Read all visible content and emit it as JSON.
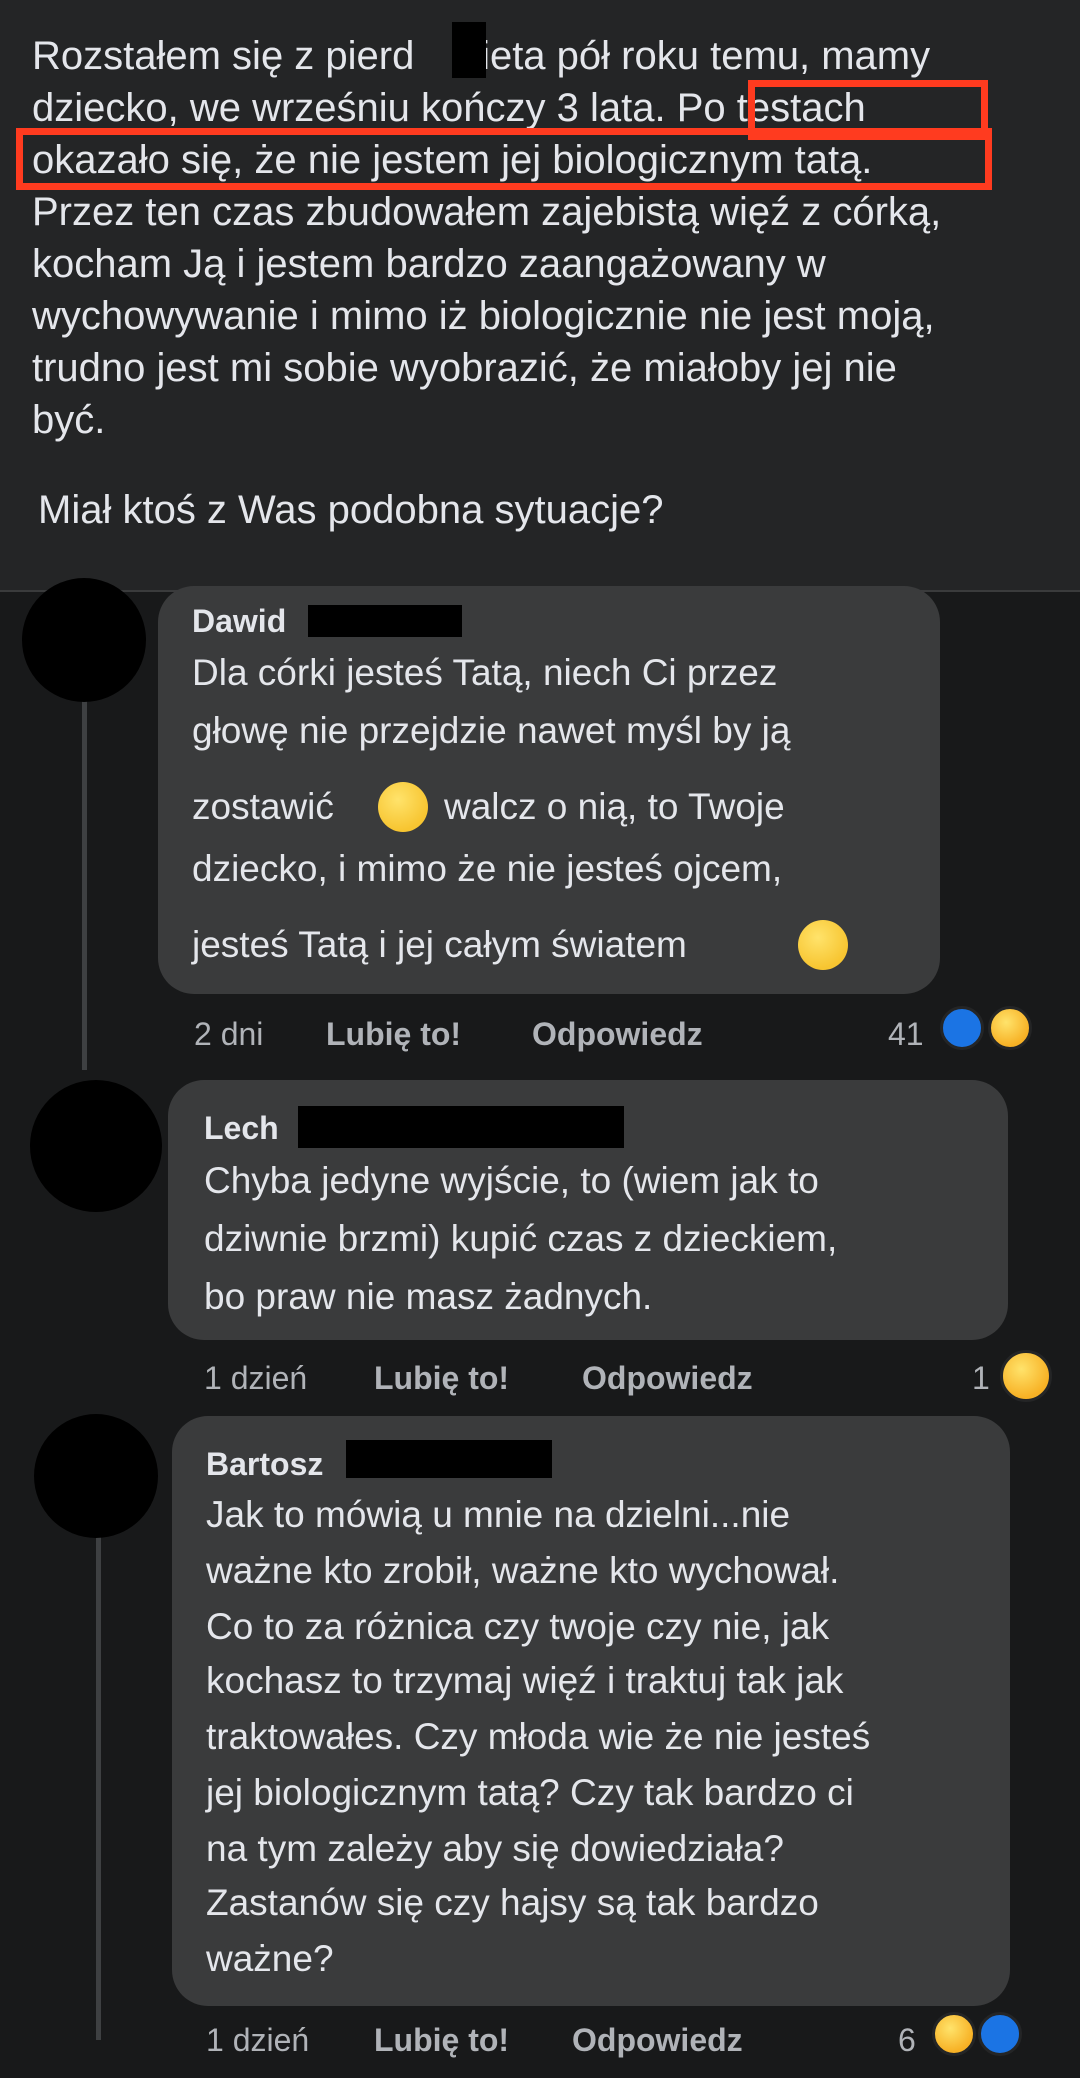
{
  "post": {
    "text": "Rozstałem się z pierd    nieta pół roku temu, mamy\ndziecko, we wrześniu kończy 3 lata. Po testach\nokazało się, że nie jestem jej biologicznym tatą.\nPrzez ten czas zbudowałem zajebistą więź z córką,\nkocham Ją i jestem bardzo zaangażowany w\nwychowywanie i mimo iż biologicznie nie jest moją,\ntrudno jest mi sobie wyobrazić, że miałoby jej nie\nbyć.",
    "question": "Miał ktoś z Was podobna sytuacje?"
  },
  "comments": [
    {
      "author": "Dawid",
      "lines": [
        "Dla córki jesteś Tatą, niech Ci przez",
        "głowę nie przejdzie nawet myśl by ją",
        "zostawić",
        "walcz o nią, to Twoje",
        "dziecko, i mimo że nie jesteś ojcem,",
        "jesteś Tatą i jej całym światem"
      ],
      "time": "2 dni",
      "like_label": "Lubię to!",
      "reply_label": "Odpowiedz",
      "reaction_count": "41",
      "reactions": [
        "like",
        "haha"
      ]
    },
    {
      "author": "Lech",
      "lines": [
        "Chyba jedyne wyjście, to (wiem jak to",
        "dziwnie brzmi) kupić czas z dzieckiem,",
        "bo praw nie masz żadnych."
      ],
      "time": "1 dzień",
      "like_label": "Lubię to!",
      "reply_label": "Odpowiedz",
      "reaction_count": "1",
      "reactions": [
        "wow"
      ]
    },
    {
      "author": "Bartosz",
      "lines": [
        "Jak to mówią u mnie na dzielni...nie",
        "ważne kto zrobił, ważne kto wychował.",
        "Co to za różnica czy twoje czy nie, jak",
        "kochasz to trzymaj więź i traktuj tak jak",
        "traktowałes. Czy młoda wie że nie jesteś",
        "jej biologicznym tatą? Czy tak bardzo ci",
        "na tym zależy aby się dowiedziała?",
        "Zastanów się czy hajsy są tak bardzo",
        "ważne?"
      ],
      "time": "1 dzień",
      "like_label": "Lubię to!",
      "reply_label": "Odpowiedz",
      "reaction_count": "6",
      "reactions": [
        "haha",
        "like"
      ]
    }
  ],
  "colors": {
    "background": "#18191a",
    "post_background": "#242526",
    "bubble": "#3a3b3c",
    "text": "#e4e6eb",
    "meta_text": "#b0b3b8",
    "highlight": "#ff3b1f",
    "like_blue": "#1b74e4"
  }
}
